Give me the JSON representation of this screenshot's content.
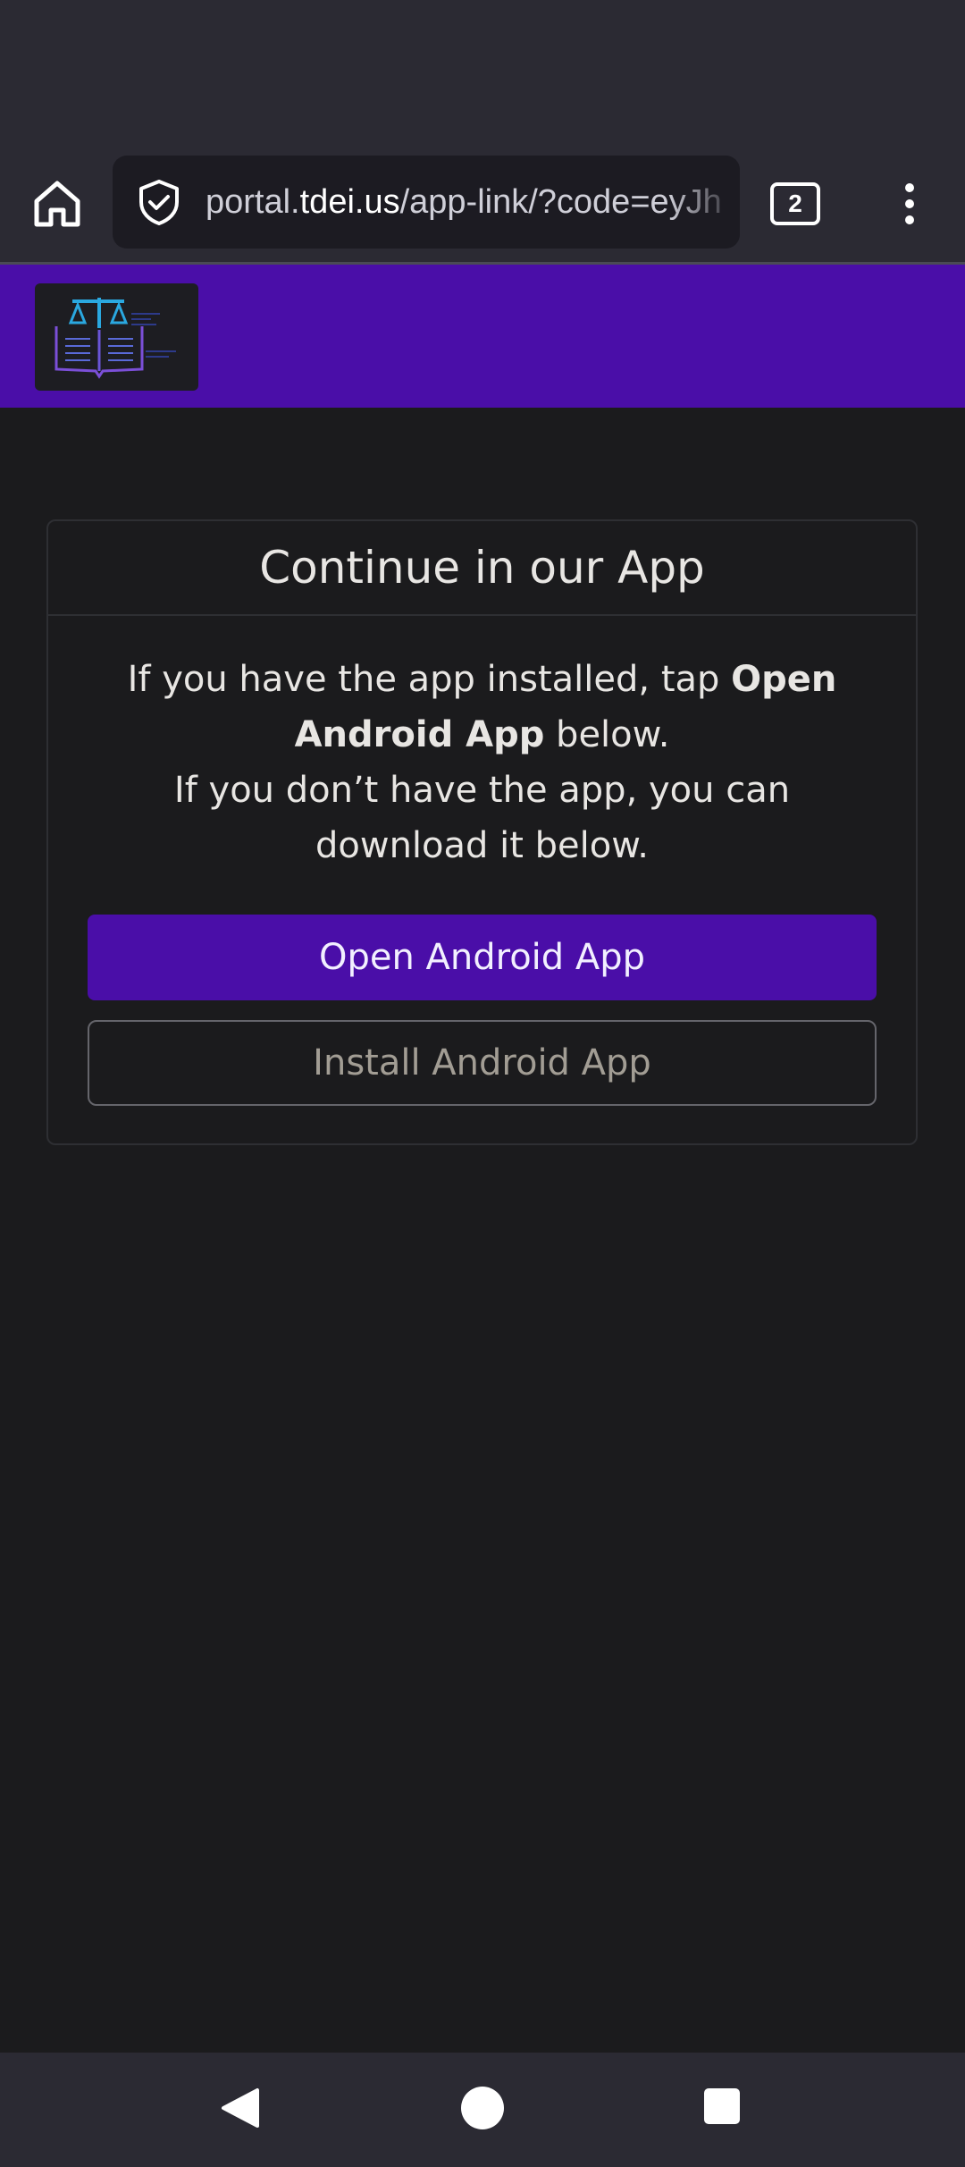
{
  "browser": {
    "url_prefix": "portal.",
    "url_host": "tdei.us",
    "url_path": "/app-link/?code=eyJh",
    "tab_count": "2",
    "icons": {
      "home": "home-icon",
      "security": "shield-check-icon",
      "menu": "kebab-menu-icon"
    }
  },
  "header": {
    "logo": "tdei-logo-icon",
    "brand_color": "#4a0ea8"
  },
  "card": {
    "title": "Continue in our App",
    "line1_prefix": "If you have the app installed, tap ",
    "line1_bold": "Open Android App",
    "line1_suffix": " below.",
    "line2": "If you don’t have the app, you can download it below.",
    "open_button": "Open Android App",
    "install_button": "Install Android App"
  },
  "navigation": {
    "back": "back-triangle-icon",
    "home": "home-circle-icon",
    "recents": "recents-square-icon"
  }
}
